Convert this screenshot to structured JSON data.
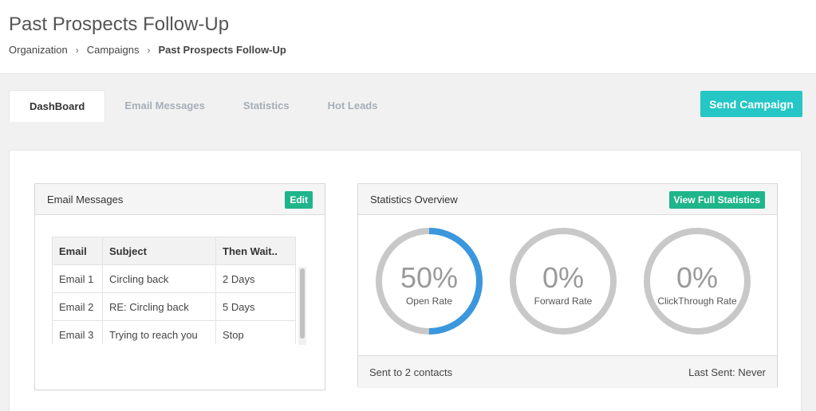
{
  "header": {
    "title": "Past Prospects Follow-Up",
    "breadcrumb": [
      {
        "label": "Organization"
      },
      {
        "label": "Campaigns"
      },
      {
        "label": "Past Prospects Follow-Up"
      }
    ],
    "separator": "›"
  },
  "tabs": [
    {
      "label": "DashBoard",
      "active": true
    },
    {
      "label": "Email Messages",
      "active": false
    },
    {
      "label": "Statistics",
      "active": false
    },
    {
      "label": "Hot Leads",
      "active": false
    }
  ],
  "send_button": {
    "label": "Send Campaign",
    "color": "#26c6c6"
  },
  "email_panel": {
    "title": "Email Messages",
    "edit_label": "Edit",
    "columns": [
      "Email",
      "Subject",
      "Then Wait.."
    ],
    "rows": [
      [
        "Email 1",
        "Circling back",
        "2 Days"
      ],
      [
        "Email 2",
        "RE: Circling back",
        "5 Days"
      ],
      [
        "Email 3",
        "Trying to reach you",
        "Stop"
      ]
    ]
  },
  "stats_panel": {
    "title": "Statistics Overview",
    "view_label": "View Full Statistics",
    "gauges": [
      {
        "value": "50%",
        "label": "Open Rate",
        "fraction": 0.5
      },
      {
        "value": "0%",
        "label": "Forward Rate",
        "fraction": 0
      },
      {
        "value": "0%",
        "label": "ClickThrough Rate",
        "fraction": 0
      }
    ],
    "sent_to": "Sent to 2 contacts",
    "last_sent": "Last Sent: Never"
  },
  "colors": {
    "accent_teal": "#26c6c6",
    "button_green": "#1fb58a",
    "gauge_fill": "#3a97de",
    "gauge_track": "#c8c8c8"
  }
}
